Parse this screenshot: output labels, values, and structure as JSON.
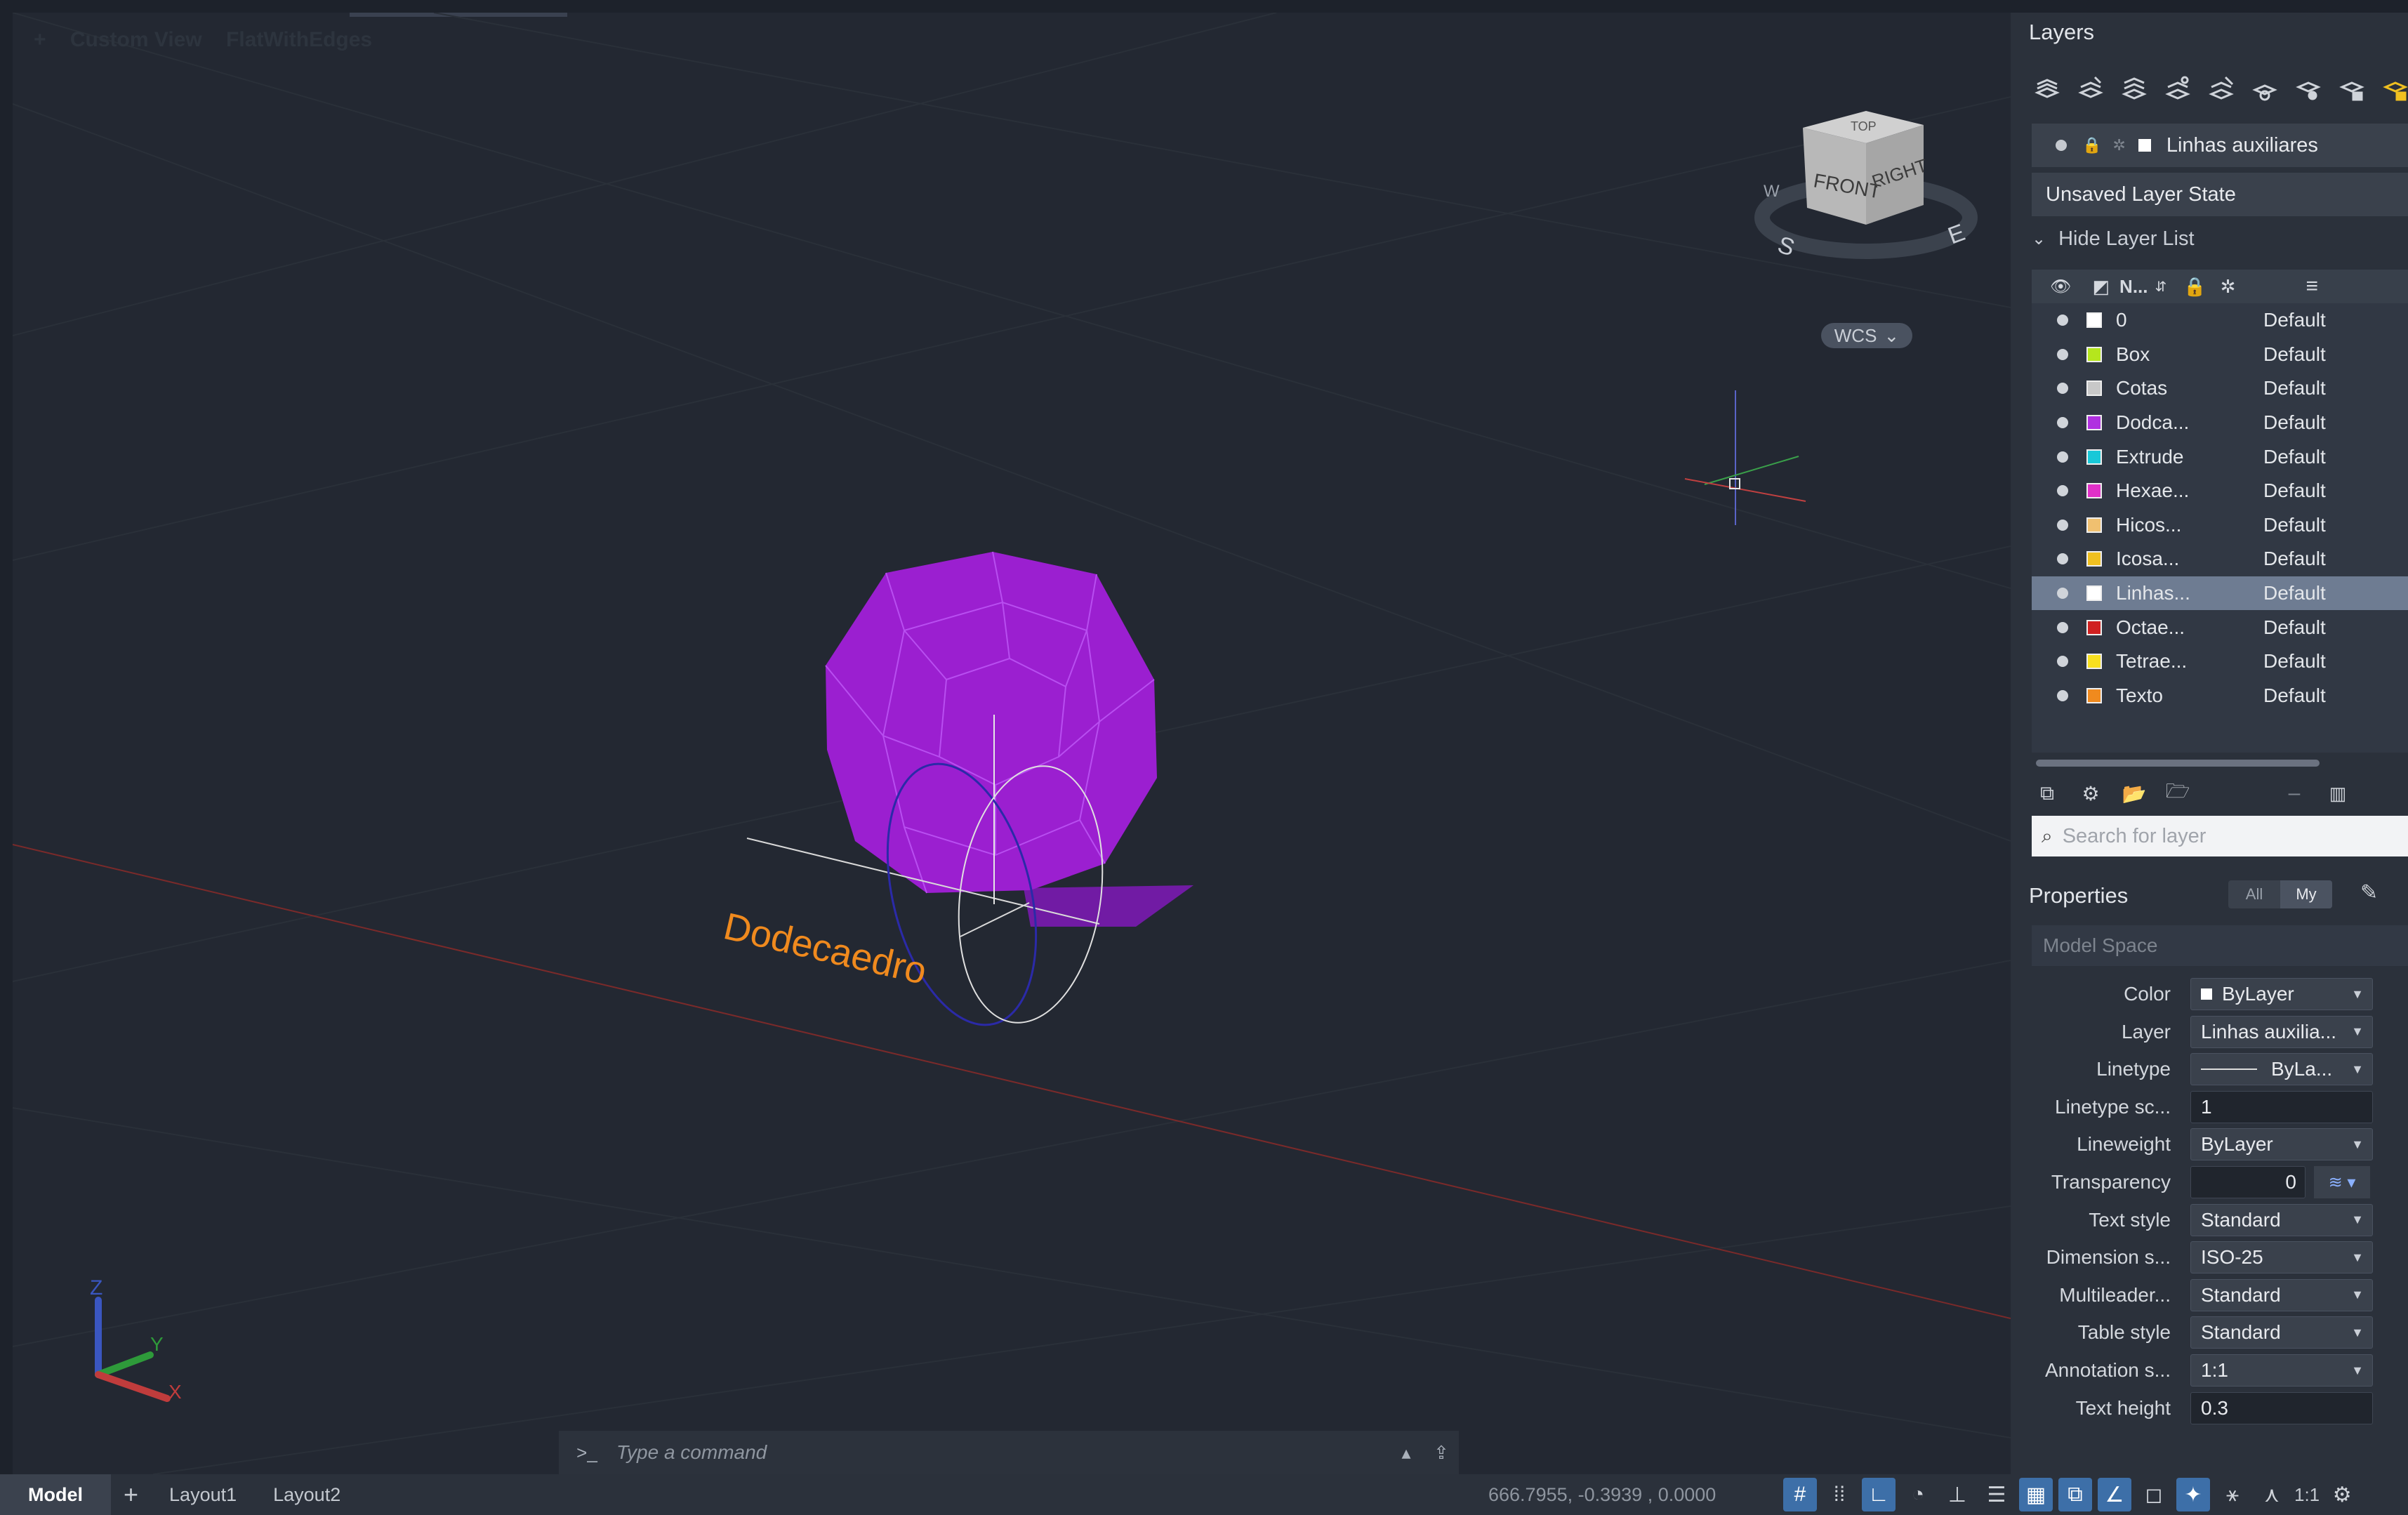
{
  "viewport": {
    "view_controls": [
      "+",
      "Custom View",
      "FlatWithEdges"
    ],
    "viewcube": {
      "top": "TOP",
      "front": "FRONT",
      "right": "RIGHT",
      "compass": [
        "W",
        "S",
        "E"
      ]
    },
    "wcs_label": "WCS",
    "object_label": "Dodecaedro",
    "object_color": "#9b1fd0",
    "label_color": "#f08a1e",
    "ucs": {
      "x": "X",
      "y": "Y",
      "z": "Z"
    }
  },
  "command_line": {
    "prompt": ">_",
    "placeholder": "Type a command"
  },
  "bottom_bar": {
    "tabs": [
      "Model",
      "+",
      "Layout1",
      "Layout2"
    ],
    "coordinates": "666.7955, -0.3939 , 0.0000",
    "scale": "1:1"
  },
  "layers_panel": {
    "title": "Layers",
    "current_layer": "Linhas auxiliares",
    "layer_state": "Unsaved Layer State",
    "hide_list_label": "Hide Layer List",
    "column_name": "N...",
    "layers": [
      {
        "name": "0",
        "linetype": "Default",
        "color": "#ffffff"
      },
      {
        "name": "Box",
        "linetype": "Default",
        "color": "#b5e61d"
      },
      {
        "name": "Cotas",
        "linetype": "Default",
        "color": "#c8c8c8"
      },
      {
        "name": "Dodca...",
        "linetype": "Default",
        "color": "#b030e0"
      },
      {
        "name": "Extrude",
        "linetype": "Default",
        "color": "#18c8d8"
      },
      {
        "name": "Hexae...",
        "linetype": "Default",
        "color": "#e030c8"
      },
      {
        "name": "Hicos...",
        "linetype": "Default",
        "color": "#f0c070"
      },
      {
        "name": "Icosa...",
        "linetype": "Default",
        "color": "#f0c020"
      },
      {
        "name": "Linhas...",
        "linetype": "Default",
        "color": "#ffffff",
        "selected": true
      },
      {
        "name": "Octae...",
        "linetype": "Default",
        "color": "#d02020"
      },
      {
        "name": "Tetrae...",
        "linetype": "Default",
        "color": "#f8e020"
      },
      {
        "name": "Texto",
        "linetype": "Default",
        "color": "#f08a1e"
      }
    ],
    "search_placeholder": "Search for layer"
  },
  "properties_panel": {
    "title": "Properties",
    "filter_all": "All",
    "filter_my": "My",
    "space": "Model Space",
    "rows": [
      {
        "label": "Color",
        "value": "ByLayer"
      },
      {
        "label": "Layer",
        "value": "Linhas auxilia..."
      },
      {
        "label": "Linetype",
        "value": "ByLa..."
      },
      {
        "label": "Linetype sc...",
        "value": "1"
      },
      {
        "label": "Lineweight",
        "value": "ByLayer"
      },
      {
        "label": "Transparency",
        "value": "0"
      },
      {
        "label": "Text style",
        "value": "Standard"
      },
      {
        "label": "Dimension s...",
        "value": "ISO-25"
      },
      {
        "label": "Multileader...",
        "value": "Standard"
      },
      {
        "label": "Table style",
        "value": "Standard"
      },
      {
        "label": "Annotation s...",
        "value": "1:1"
      },
      {
        "label": "Text height",
        "value": "0.3"
      }
    ]
  }
}
